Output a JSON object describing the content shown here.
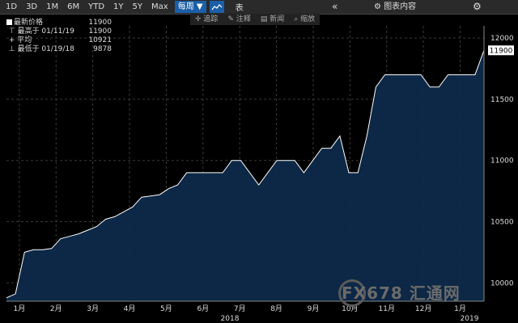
{
  "toolbar": {
    "ranges": [
      "1D",
      "3D",
      "1M",
      "6M",
      "YTD",
      "1Y",
      "5Y",
      "Max"
    ],
    "frequency": "每周 ▼",
    "table_label": "表",
    "collapse": "«",
    "chart_content": "图表内容",
    "settings_icon": "gear-icon"
  },
  "subtoolbar": {
    "track": "追踪",
    "annotate": "注释",
    "news": "新闻",
    "zoom": "缩放"
  },
  "legend": {
    "latest_label": "最新价格",
    "latest_value": "11900",
    "high_label": "最高于 01/11/19",
    "high_value": "11900",
    "avg_label": "平均",
    "avg_value": "10921",
    "low_label": "最低于 01/19/18",
    "low_value": "9878"
  },
  "last_price_tag": "11900",
  "watermark": "FX678 汇通网",
  "colors": {
    "fill": "#0e2a4a",
    "line": "#ffffff",
    "grid": "#3a3a3a",
    "accent": "#1c5fa8"
  },
  "chart_data": {
    "type": "area",
    "ylim": [
      9850,
      12100
    ],
    "yticks": [
      10000,
      10500,
      11000,
      11500,
      12000
    ],
    "xlabels": [
      "1月",
      "2月",
      "3月",
      "4月",
      "5月",
      "6月",
      "7月",
      "8月",
      "9月",
      "10月",
      "11月",
      "12月",
      "1月"
    ],
    "year_labels": [
      "2018",
      "2019"
    ],
    "values": [
      9878,
      9910,
      10250,
      10270,
      10270,
      10280,
      10360,
      10380,
      10400,
      10430,
      10460,
      10520,
      10540,
      10580,
      10620,
      10700,
      10710,
      10720,
      10770,
      10800,
      10900,
      10900,
      10900,
      10900,
      10900,
      11000,
      11000,
      10900,
      10800,
      10900,
      11000,
      11000,
      11000,
      10900,
      11000,
      11100,
      11100,
      11200,
      10900,
      10900,
      11200,
      11600,
      11700,
      11700,
      11700,
      11700,
      11700,
      11600,
      11600,
      11700,
      11700,
      11700,
      11700,
      11900
    ],
    "grid": true
  }
}
